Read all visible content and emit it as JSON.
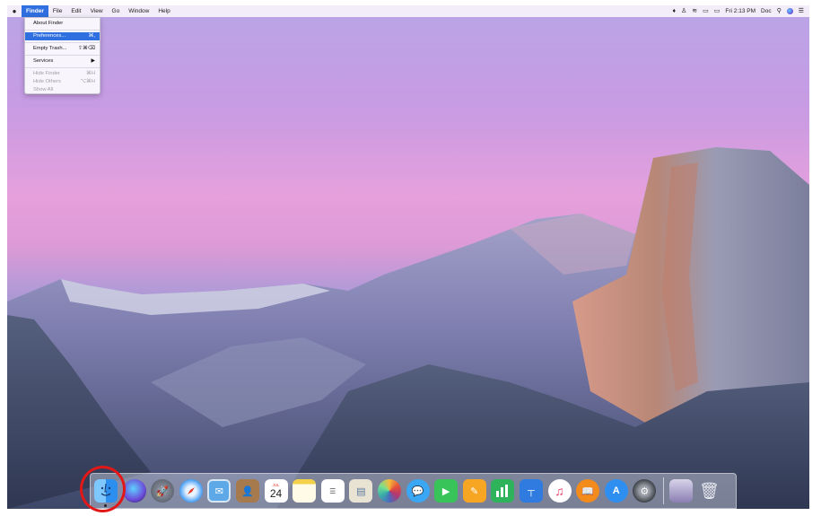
{
  "menubar": {
    "apple": "",
    "items": [
      "Finder",
      "File",
      "Edit",
      "View",
      "Go",
      "Window",
      "Help"
    ],
    "status": {
      "clock": "Fri 2:13 PM",
      "user": "Doc"
    }
  },
  "finder_menu": {
    "items": [
      {
        "label": "About Finder",
        "shortcut": ""
      },
      {
        "label": "Preferences...",
        "shortcut": "⌘,"
      },
      {
        "label": "Empty Trash...",
        "shortcut": "⇧⌘⌫"
      },
      {
        "label": "Services",
        "shortcut": "▶"
      },
      {
        "label": "Hide Finder",
        "shortcut": "⌘H"
      },
      {
        "label": "Hide Others",
        "shortcut": "⌥⌘H"
      },
      {
        "label": "Show All",
        "shortcut": ""
      }
    ]
  },
  "dock": {
    "calendar_day": "24",
    "calendar_month": "JUL"
  },
  "colors": {
    "accent": "#2f6fe0",
    "highlight": "#e21818"
  }
}
